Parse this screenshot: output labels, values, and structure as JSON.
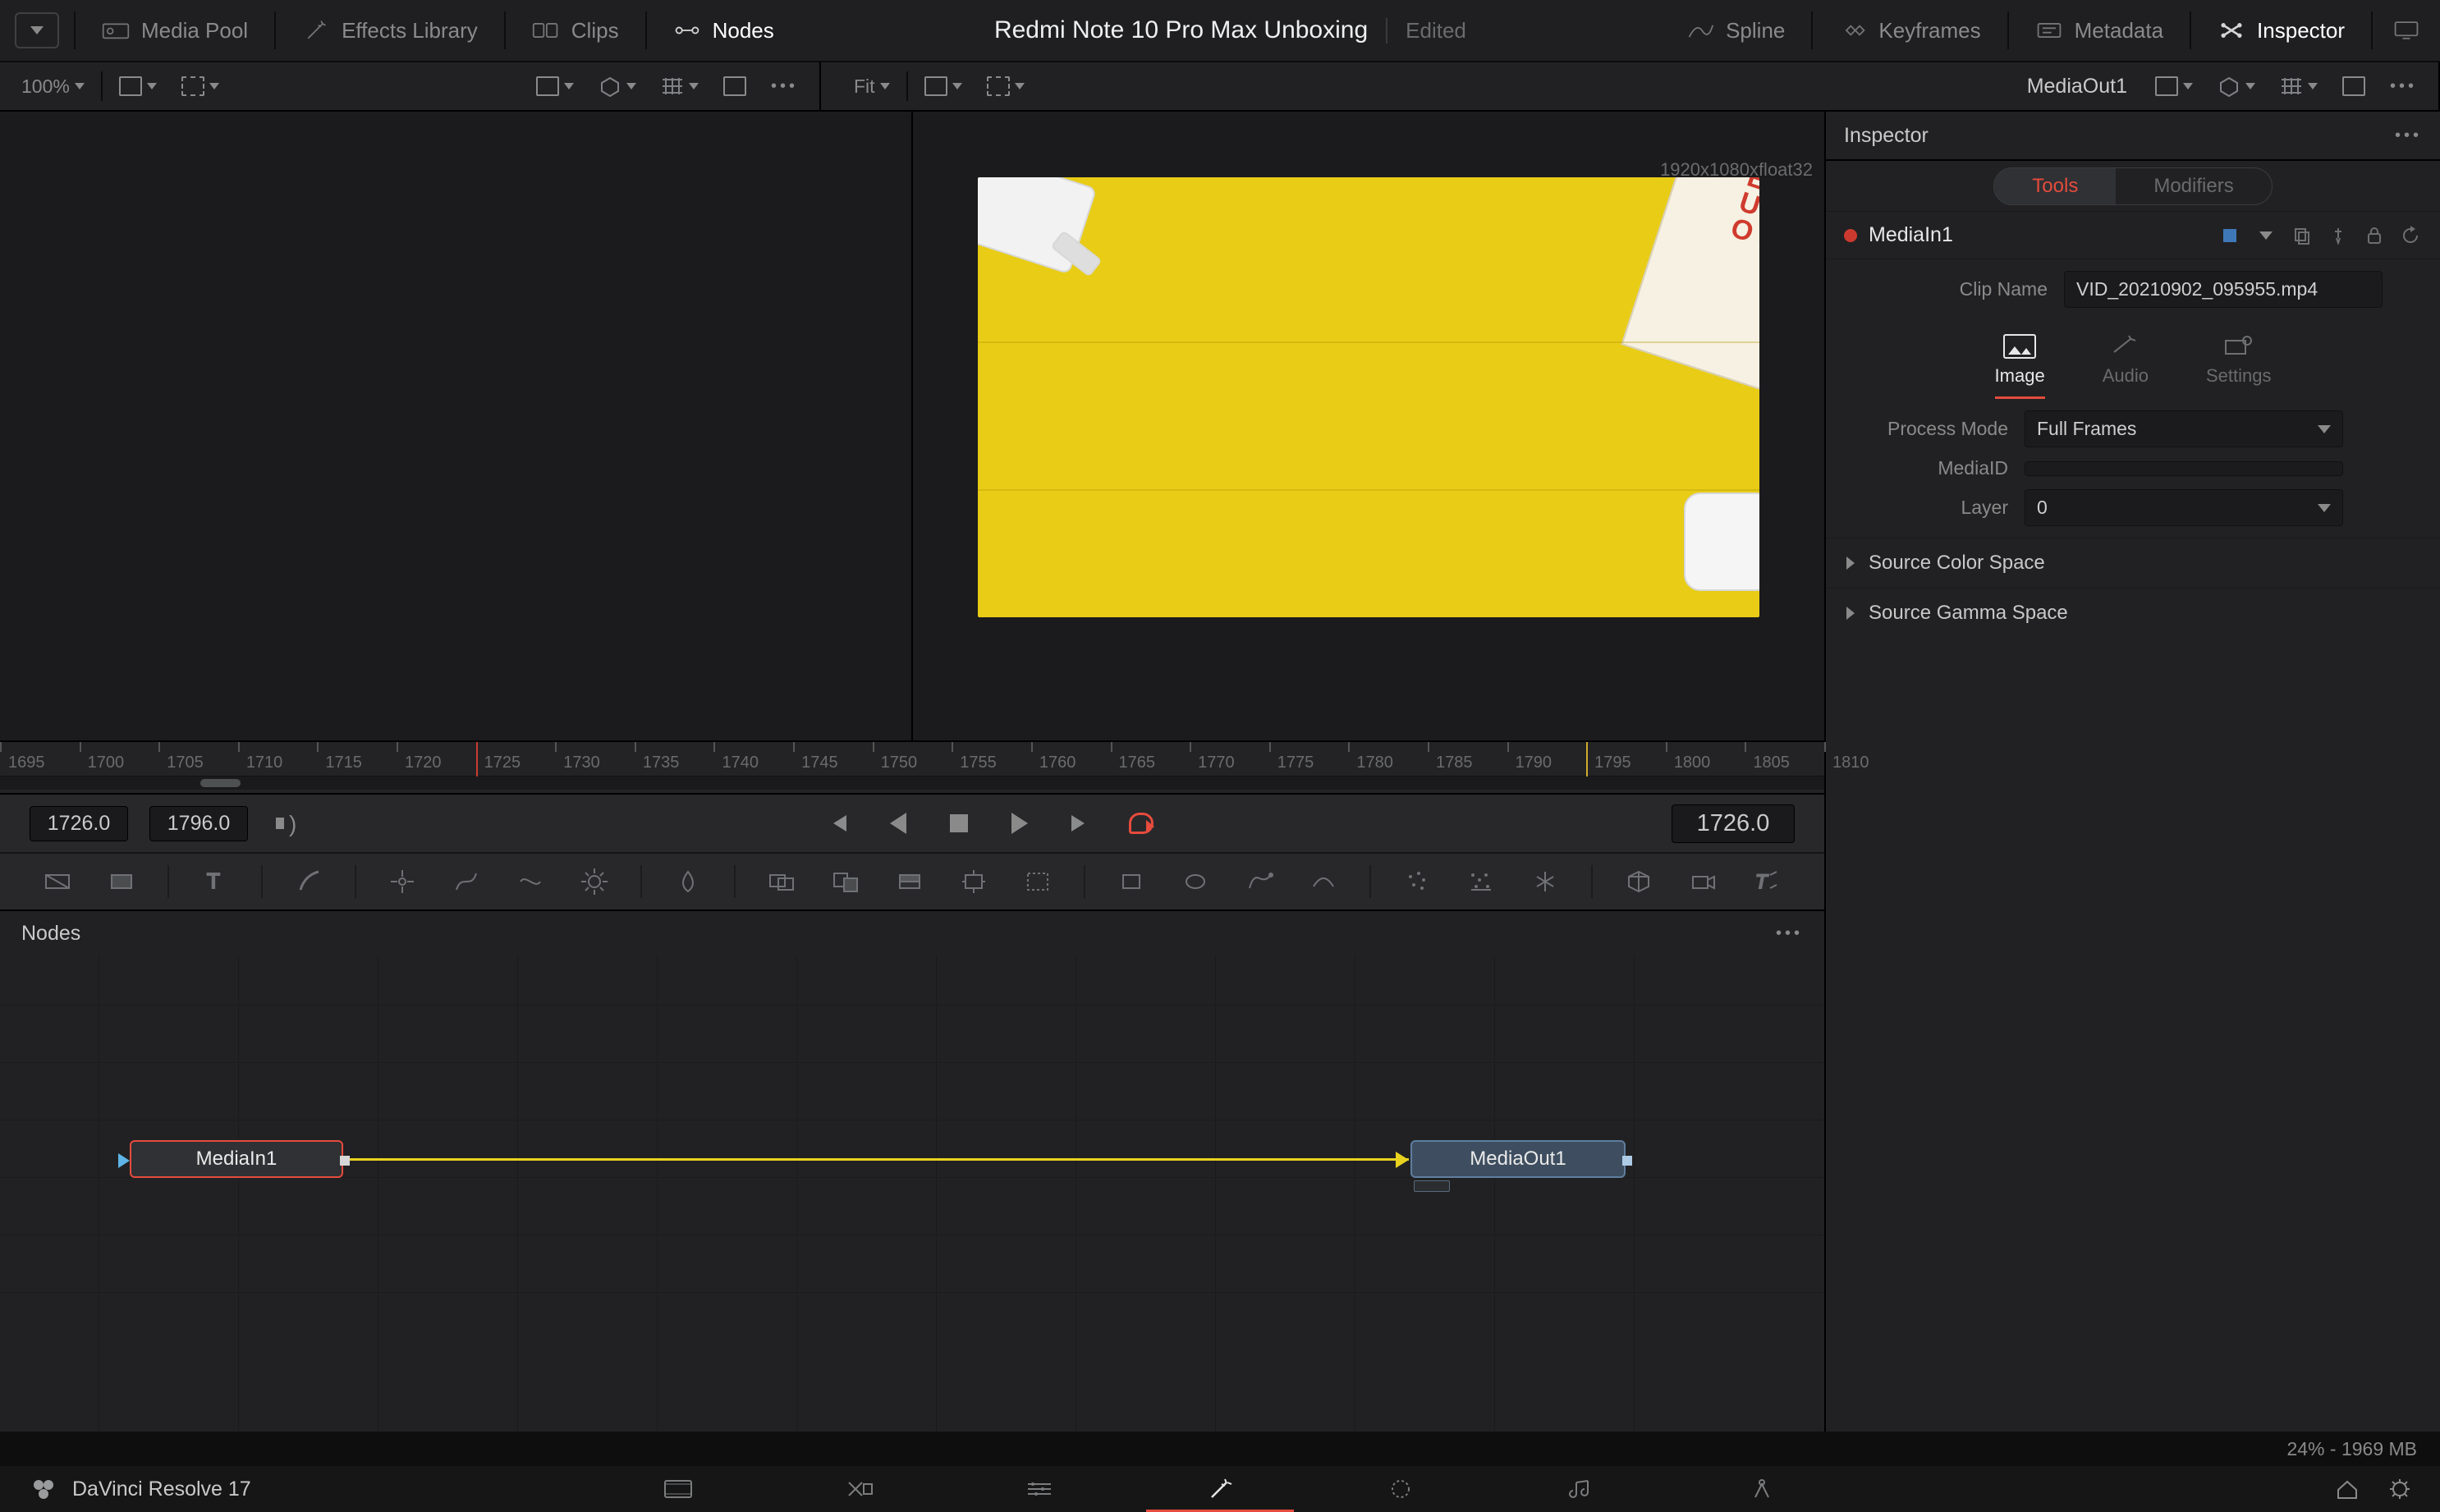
{
  "top": {
    "media_pool": "Media Pool",
    "effects_library": "Effects Library",
    "clips": "Clips",
    "nodes": "Nodes",
    "spline": "Spline",
    "keyframes": "Keyframes",
    "metadata": "Metadata",
    "inspector": "Inspector"
  },
  "title": {
    "project": "Redmi Note 10 Pro Max Unboxing",
    "status": "Edited"
  },
  "sub_left": {
    "zoom": "100%"
  },
  "sub_right": {
    "fit": "Fit",
    "active_out": "MediaOut1"
  },
  "viewer": {
    "resolution": "1920x1080xfloat32"
  },
  "ruler": {
    "start": 1695,
    "step": 5,
    "count": 24,
    "playhead_red": 1725,
    "playhead_yellow": 1795,
    "scroll_thumb_left_pct": 11,
    "scroll_thumb_width_pct": 2.2
  },
  "transport": {
    "in_time": "1726.0",
    "out_time": "1796.0",
    "current": "1726.0"
  },
  "nodes_panel": {
    "title": "Nodes"
  },
  "nodes": {
    "in": "MediaIn1",
    "out": "MediaOut1"
  },
  "inspector": {
    "header": "Inspector",
    "tab_tools": "Tools",
    "tab_modifiers": "Modifiers",
    "node_name": "MediaIn1",
    "clip_name_label": "Clip Name",
    "clip_name": "VID_20210902_095955.mp4",
    "subtabs": {
      "image": "Image",
      "audio": "Audio",
      "settings": "Settings"
    },
    "labels": {
      "process_mode": "Process Mode",
      "media_id": "MediaID",
      "layer": "Layer"
    },
    "values": {
      "process_mode": "Full Frames",
      "media_id": "",
      "layer": "0"
    },
    "sections": {
      "source_color": "Source Color Space",
      "source_gamma": "Source Gamma Space"
    }
  },
  "status": {
    "mem": "24% - 1969 MB"
  },
  "bottom": {
    "app": "DaVinci Resolve 17"
  }
}
